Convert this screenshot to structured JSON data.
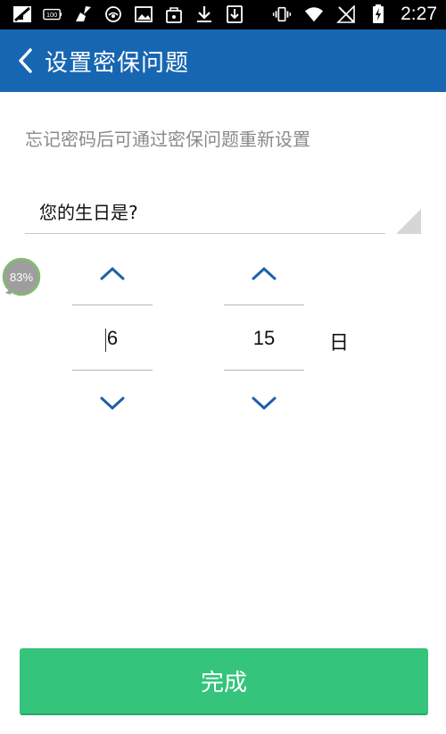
{
  "status_bar": {
    "time": "2:27",
    "battery_saver_label": "100",
    "left_icons": [
      "signal-off-icon",
      "battery-100-icon",
      "broom-icon",
      "eye-icon",
      "image-icon",
      "bag-icon",
      "download-icon",
      "download-box-icon"
    ],
    "right_icons": [
      "vibrate-icon",
      "wifi-icon",
      "no-signal-icon",
      "battery-charging-icon"
    ]
  },
  "header": {
    "title": "设置密保问题",
    "back_icon": "chevron-left-icon",
    "background_color": "#1766b2"
  },
  "main": {
    "hint": "忘记密码后可通过密保问题重新设置",
    "question": {
      "value": "您的生日是?"
    },
    "floating_badge": {
      "text": "83%"
    },
    "month_picker": {
      "value": "6"
    },
    "day_picker": {
      "value": "15",
      "unit": "日"
    }
  },
  "footer": {
    "done_label": "完成",
    "done_color": "#34c47c"
  }
}
